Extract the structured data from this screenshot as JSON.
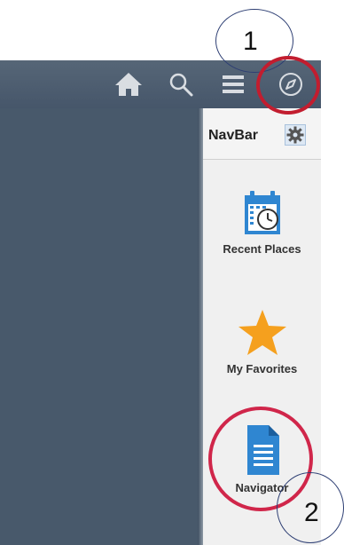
{
  "toolbar": {
    "icons": [
      "home-icon",
      "search-icon",
      "hamburger-menu-icon",
      "navbar-compass-icon"
    ]
  },
  "navbar": {
    "title": "NavBar",
    "tiles": [
      {
        "label": "Recent Places",
        "icon": "calendar-clock-icon"
      },
      {
        "label": "My Favorites",
        "icon": "star-icon"
      },
      {
        "label": "Navigator",
        "icon": "document-icon"
      }
    ]
  },
  "callouts": [
    "1",
    "2"
  ],
  "colors": {
    "header": "#4f5f71",
    "panel_dark": "#48596b",
    "highlight_red": "#c21d2f",
    "accent_blue": "#2f86d1",
    "star_orange": "#f5a01e"
  }
}
